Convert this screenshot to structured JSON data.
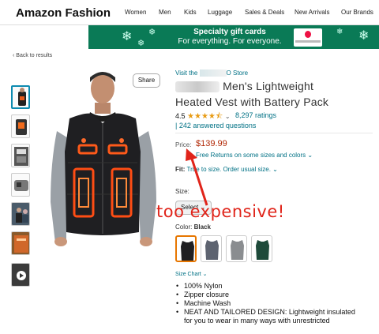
{
  "header": {
    "brand": "Amazon Fashion",
    "nav": [
      "Women",
      "Men",
      "Kids",
      "Luggage",
      "Sales & Deals",
      "New Arrivals",
      "Our Brands"
    ]
  },
  "banner": {
    "line1": "Specialty gift cards",
    "line2": "For everything. For everyone.",
    "icon": "gift-card-apple"
  },
  "back_link": "‹ Back to results",
  "product": {
    "visit_prefix": "Visit the",
    "visit_suffix": "O Store",
    "title_line1": "Men's Lightweight",
    "title_line2": "Heated Vest with Battery Pack",
    "rating_value": "4.5",
    "stars": "★★★★⯪",
    "ratings_count": "8,297 ratings",
    "answered": "242 answered questions",
    "price_label": "Price:",
    "price": "$139.99",
    "returns": "Free Returns on some sizes and colors ⌄",
    "fit_label": "Fit:",
    "fit_value": "True to size. Order usual size. ⌄",
    "size_label": "Size:",
    "size_select": "Select ⌄",
    "color_label": "Color:",
    "color_value": "Black",
    "size_chart": "Size Chart ⌄",
    "bullets": [
      "100% Nylon",
      "Zipper closure",
      "Machine Wash",
      "NEAT AND TAILORED DESIGN: Lightweight insulated",
      "for you to wear in many ways with unrestricted"
    ]
  },
  "share_label": "Share",
  "annotation": "too expensive!",
  "colors": {
    "accent_link": "#007185",
    "price": "#b12704",
    "annotation": "#e0241a",
    "banner": "#0a7a56"
  }
}
